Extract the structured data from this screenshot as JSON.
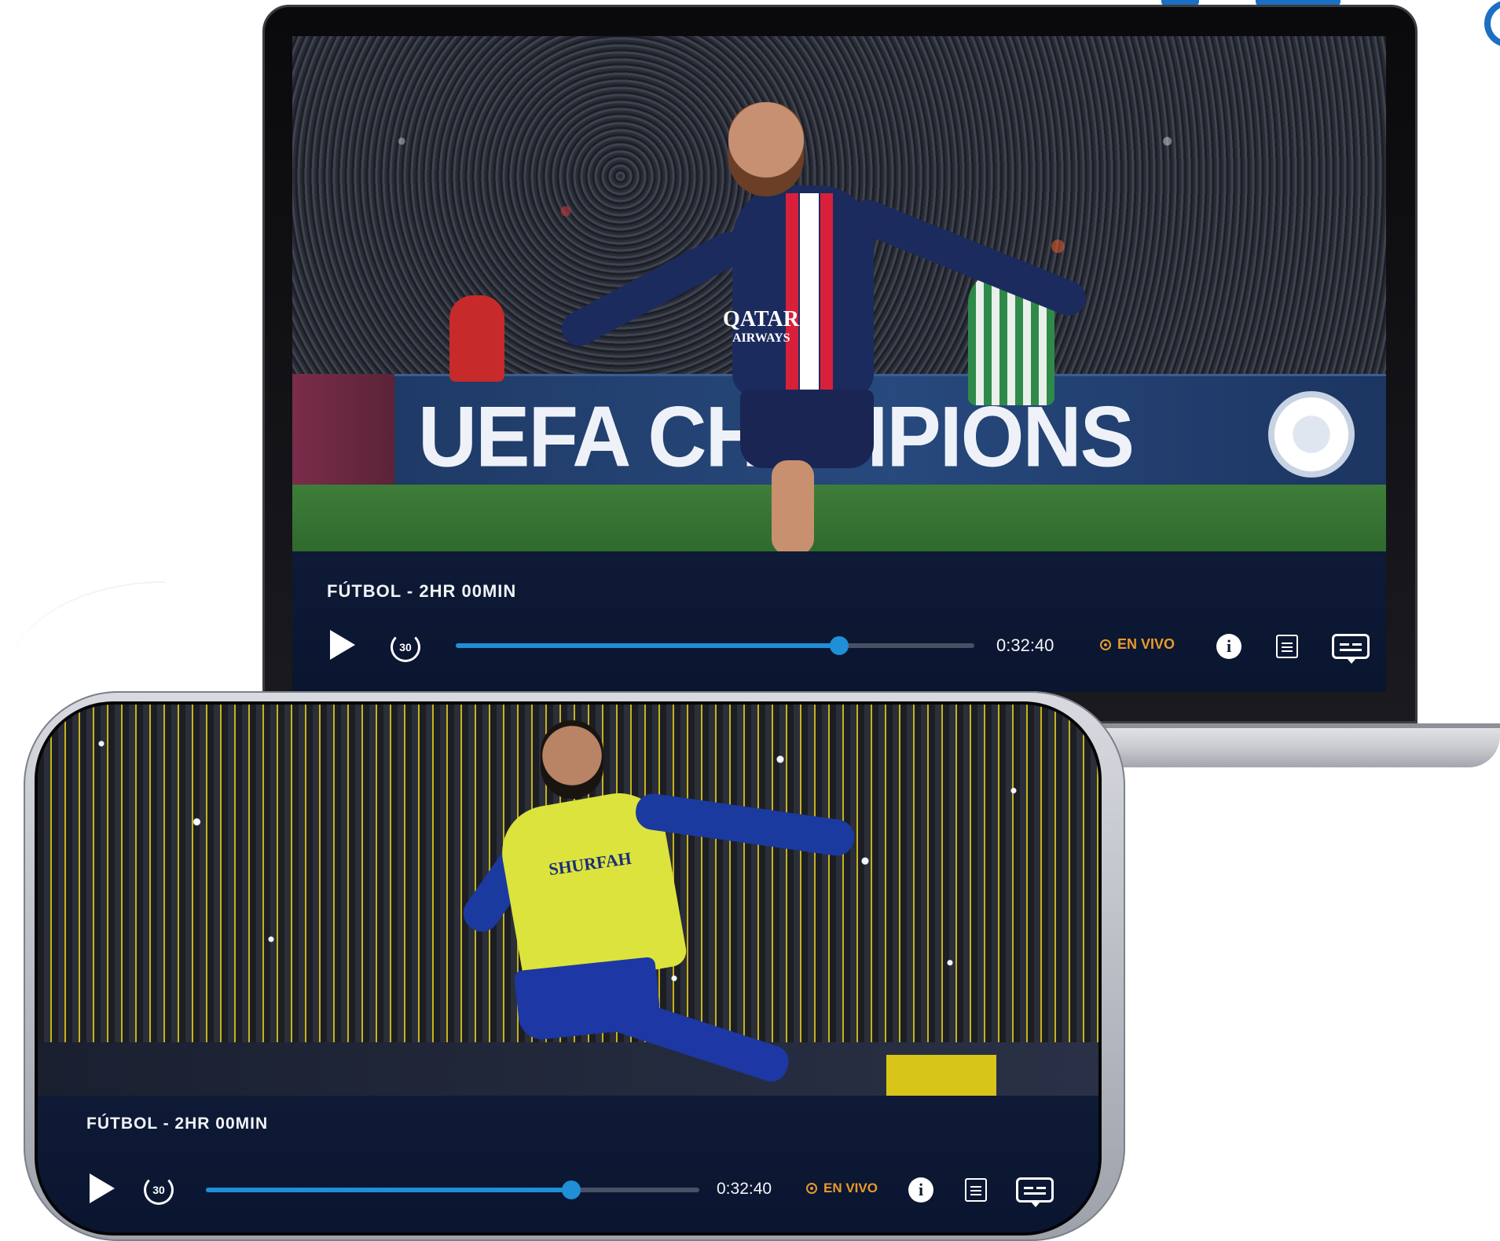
{
  "laptop_player": {
    "title": "FÚTBOL - 2HR 00MIN",
    "time": "0:32:40",
    "live_label": "EN VIVO",
    "progress": 0.74,
    "replay_seconds": "30",
    "banner_text": "UEFA CHAMPIONS LEAGUE",
    "jersey_sponsor": "QATAR",
    "jersey_sponsor_sub": "AIRWAYS"
  },
  "phone_player": {
    "title": "FÚTBOL - 2HR 00MIN",
    "time": "0:32:40",
    "live_label": "EN VIVO",
    "progress": 0.74,
    "replay_seconds": "30",
    "jersey_sponsor": "SHURFAH"
  },
  "colors": {
    "accent": "#1f8fd6",
    "live": "#e89a2c",
    "control_bg": "#0b1430"
  },
  "icons": [
    "play-icon",
    "replay-30-icon",
    "live-indicator-icon",
    "info-icon",
    "episodes-list-icon",
    "subtitles-icon"
  ]
}
